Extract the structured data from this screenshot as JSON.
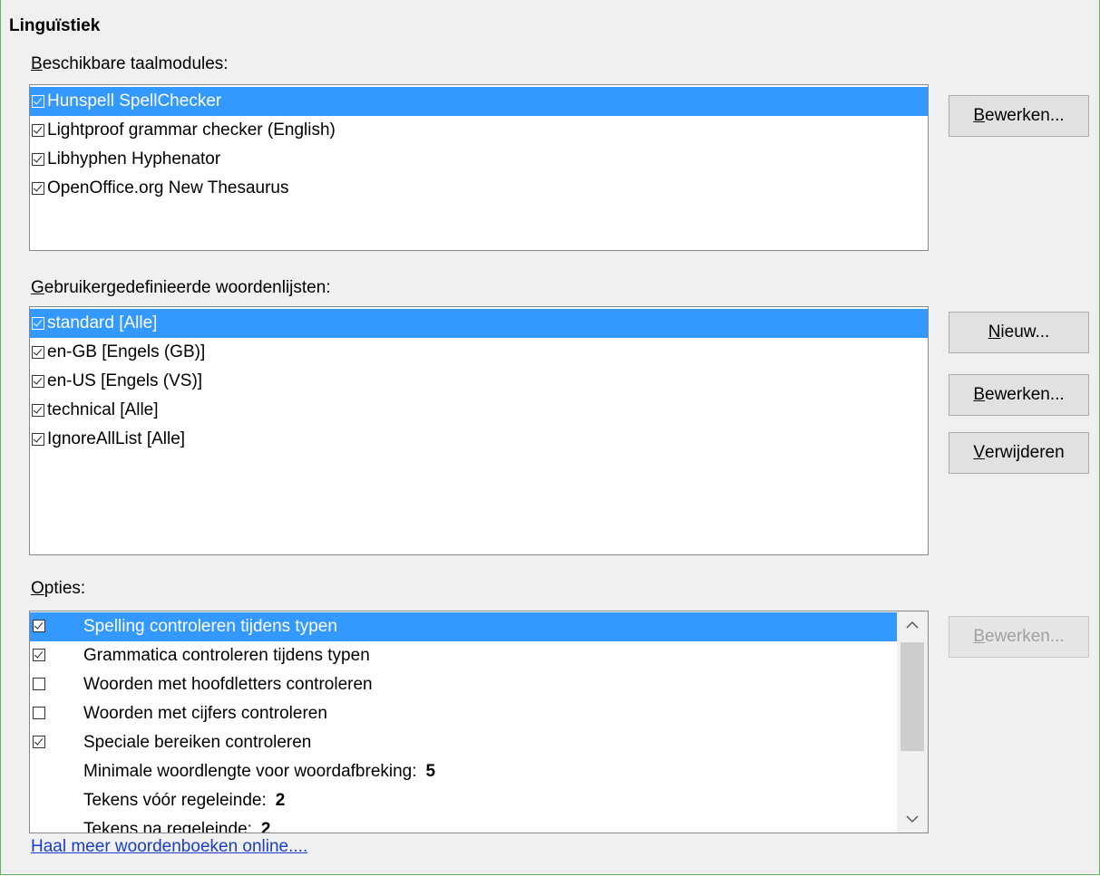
{
  "section_title": "Linguïstiek",
  "modules": {
    "label_accel": "B",
    "label_rest": "eschikbare taalmodules:",
    "items": [
      {
        "label": "Hunspell SpellChecker",
        "checked": true,
        "selected": true
      },
      {
        "label": "Lightproof grammar checker (English)",
        "checked": true,
        "selected": false
      },
      {
        "label": "Libhyphen Hyphenator",
        "checked": true,
        "selected": false
      },
      {
        "label": "OpenOffice.org New Thesaurus",
        "checked": true,
        "selected": false
      }
    ],
    "edit_button_accel": "B",
    "edit_button_rest": "ewerken..."
  },
  "dictionaries": {
    "label_accel": "G",
    "label_rest": "ebruikergedefinieerde woordenlijsten:",
    "items": [
      {
        "label": "standard [Alle]",
        "checked": true,
        "selected": true
      },
      {
        "label": "en-GB [Engels (GB)]",
        "checked": true,
        "selected": false
      },
      {
        "label": "en-US [Engels (VS)]",
        "checked": true,
        "selected": false
      },
      {
        "label": "technical [Alle]",
        "checked": true,
        "selected": false
      },
      {
        "label": "IgnoreAllList [Alle]",
        "checked": true,
        "selected": false
      }
    ],
    "new_button_accel": "N",
    "new_button_rest": "ieuw...",
    "edit_button_accel": "B",
    "edit_button_rest": "ewerken...",
    "delete_button_accel": "V",
    "delete_button_rest": "erwijderen"
  },
  "options": {
    "label_accel": "O",
    "label_rest": "pties:",
    "items": [
      {
        "label": "Spelling controleren tijdens typen",
        "checkbox": true,
        "checked": true,
        "selected": true,
        "value": ""
      },
      {
        "label": "Grammatica controleren tijdens typen",
        "checkbox": true,
        "checked": true,
        "selected": false,
        "value": ""
      },
      {
        "label": "Woorden met hoofdletters controleren",
        "checkbox": true,
        "checked": false,
        "selected": false,
        "value": ""
      },
      {
        "label": "Woorden met cijfers controleren",
        "checkbox": true,
        "checked": false,
        "selected": false,
        "value": ""
      },
      {
        "label": "Speciale bereiken controleren",
        "checkbox": true,
        "checked": true,
        "selected": false,
        "value": ""
      },
      {
        "label": "Minimale woordlengte voor woordafbreking:",
        "checkbox": false,
        "checked": false,
        "selected": false,
        "value": "5"
      },
      {
        "label": "Tekens vóór regeleinde:",
        "checkbox": false,
        "checked": false,
        "selected": false,
        "value": "2"
      },
      {
        "label": "Tekens na regeleinde:",
        "checkbox": false,
        "checked": false,
        "selected": false,
        "value": "2"
      }
    ],
    "edit_button_accel": "B",
    "edit_button_rest": "ewerken...",
    "scroll_up_icon": "chevron-up-icon",
    "scroll_down_icon": "chevron-down-icon"
  },
  "link_text": "Haal meer woordenboeken online....",
  "colors": {
    "selection": "#3399ff",
    "link": "#1a3ec8",
    "frame_border": "#5fb55f"
  }
}
